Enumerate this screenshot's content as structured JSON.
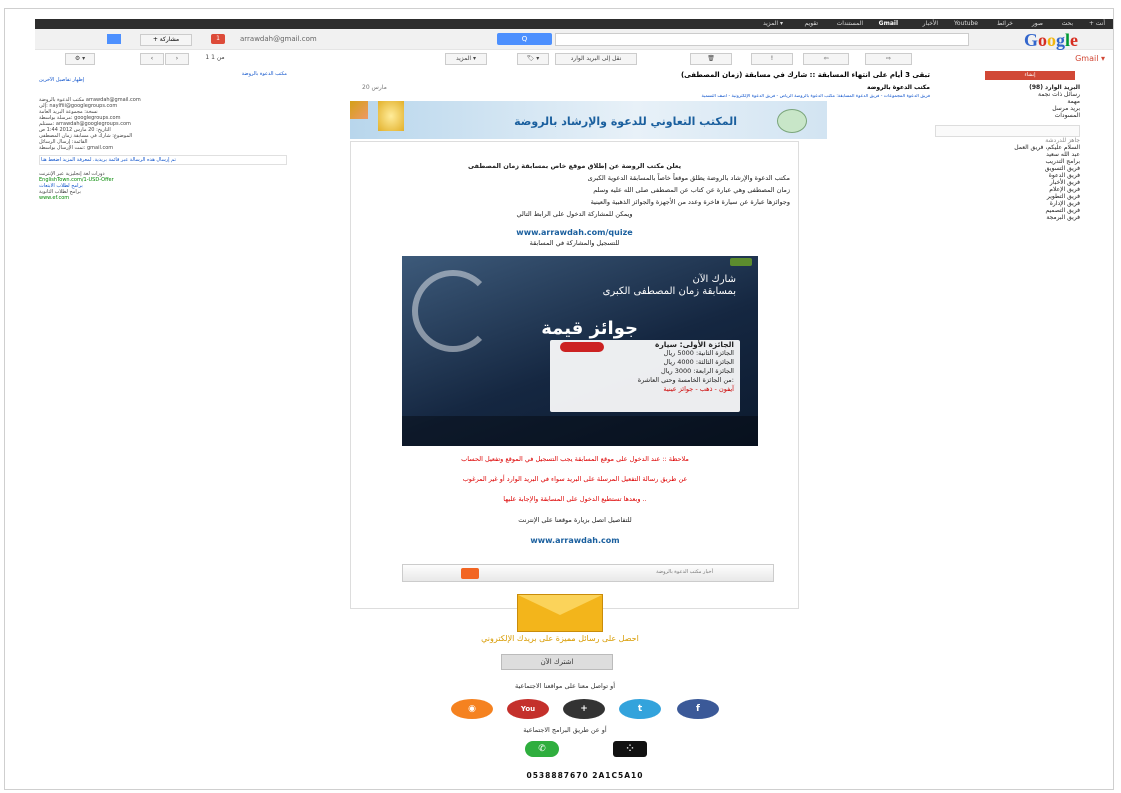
{
  "gmail": {
    "topbar_links": [
      "+ أنت",
      "بحث",
      "صور",
      "خرائط",
      "Youtube",
      "الأخبار",
      "Gmail",
      "المستندات",
      "تقويم",
      "المزيد ▾"
    ],
    "search_button": "Q",
    "account_email": "arrawdah@gmail.com",
    "share_label": "+ مشاركة",
    "gmail_label": "Gmail ▾",
    "pager": "1 من 1",
    "toolbar": {
      "archive": "⇦",
      "spam": "!",
      "delete": "🗑",
      "move": "نقل إلى البريد الوارد",
      "labels": "🏷 ▾",
      "more": "المزيد ▾"
    },
    "compose_label": "إنشاء",
    "nav_items": [
      "البريد الوارد (98)",
      "رسائل ذات نجمة",
      "مهمة",
      "بريد مرسل",
      "المسودات"
    ],
    "chat_status": "جاهز للدردشة",
    "chat_contacts": [
      "السلام عليكم، فريق العمل",
      "عبد الله سعيد",
      "برامج التدريب",
      "فريق التسويق",
      "فريق الدعوة",
      "فريق الأخبار",
      "فريق الإعلام",
      "فريق التطوير",
      "فريق الإدارة",
      "فريق التصميم",
      "فريق البرمجة"
    ]
  },
  "left_panel": {
    "header": "مكتب الدعوة بالروضة",
    "header_link": "إظهار تفاصيل الآخرين",
    "lines": [
      "مكتب الدعوة بالروضة arrawdah@gmail.com",
      "إلى: naylfiii@googlegroups.com",
      "نسخة: مجموعة البريد العامة",
      "مرسلة بواسطة: googlegroups.com",
      "مستلم: arrawdah@googlegroups.com",
      "التاريخ: 20 مارس 2012 1:44 ص",
      "الموضوع: شارك في مسابقة زمان المصطفى",
      "القائمة: إرسال الرسائل",
      "تمت الإرسال بواسطة: gmail.com"
    ],
    "notice": "تم إرسال هذه الرسالة عبر قائمة بريدية. لمعرفة المزيد اضغط هنا",
    "ads": [
      "دورات لغة إنجليزية عبر الإنترنت",
      "EnglishTown.com/1-USD-Offer",
      "برامج لطلاب الثانوية",
      "www.ef.com"
    ],
    "ad_title": "برامج لطلاب الابتعاث"
  },
  "email": {
    "subject": "تبقى 3 أيام على انتهاء المسابقة :: شارك في مسابقة (زمان المصطفى)",
    "sender": "مكتب الدعوة بالروضة",
    "date": "20 مارس",
    "header_line": "فريق الدعوة المجموعات - فريق الدعوة المسابقة: مكتب الدعوة بالروضة الرياض - فريق الدعوة الإلكترونية - أضف التسمية",
    "banner_title": "المكتب التعاوني للدعوة والإرشاد بالروضة",
    "intro_lines": [
      "يعلن مكتب الروضة عن إطلاق موقع خاص بمسابقة زمان المصطفى",
      "مكتب الدعوة والإرشاد بالروضة يطلق موقعاً خاصاً بالمسابقة الدعوية الكبرى",
      "زمان المصطفى وهي عبارة عن كتاب عن المصطفى صلى الله عليه وسلم",
      "وجوائزها عبارة عن سيارة فاخرة وعدد من الأجهزة والجوائز الذهبية والعينية",
      "ويمكن للمشاركة الدخول على الرابط التالي"
    ],
    "site_link": "www.arrawdah.com/quize",
    "register_line": "للتسجيل والمشاركة في المسابقة",
    "poster": {
      "line1": "شارك الآن",
      "line2": "بمسابقة زمان المصطفى الكبرى",
      "big": "جوائز قيمة",
      "prizes": [
        "الجائزة الأولى: سيارة",
        "الجائزة الثانية: 5000 ريال",
        "الجائزة الثالثة: 4000 ريال",
        "الجائزة الرابعة: 3000 ريال",
        "من الجائزة الخامسة وحتى العاشرة:",
        "آيفون - ذهب - جوائز عينية"
      ]
    },
    "note_red": [
      "ملاحظة :: عند الدخول على موقع المسابقة يجب التسجيل في الموقع وتفعيل الحساب",
      "عن طريق رسالة التفعيل المرسلة على البريد سواء في البريد الوارد أو غير المرغوب",
      "وبعدها تستطيع الدخول على المسابقة والإجابة عليها .."
    ],
    "note_black": "للتفاصيل اتصل بزيارة موقعنا على الإنترنت",
    "main_link": "www.arrawdah.com",
    "rss_label": "أخبار مكتب الدعوة بالروضة",
    "subscribe_text": "احصل على رسائل مميزة على بريدك الإلكتروني",
    "subscribe_button": "اشترك الآن",
    "social_text": "أو تواصل معنا على مواقعنا الاجتماعية",
    "apps_text": "أو عن طريق البرامج الاجتماعية",
    "phone_line": "0538887670   2A1C5A10",
    "social_icons": [
      "rss",
      "youtube",
      "google-plus",
      "twitter",
      "facebook"
    ],
    "app_icons": [
      "whatsapp",
      "blackberry"
    ]
  },
  "colors": {
    "gmail_red": "#d14836",
    "link_blue": "#1a5f9e",
    "poster_bg": "#152741",
    "envelope": "#f3b51b"
  }
}
